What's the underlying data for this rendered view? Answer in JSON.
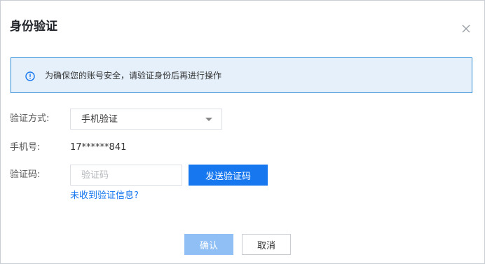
{
  "dialog": {
    "title": "身份验证",
    "close_icon": "close-icon"
  },
  "notice": {
    "icon": "info-circle-icon",
    "text": "为确保您的账号安全，请验证身份后再进行操作"
  },
  "form": {
    "method_label": "验证方式:",
    "method_value": "手机验证",
    "phone_label": "手机号:",
    "phone_value": "17******841",
    "code_label": "验证码:",
    "code_placeholder": "验证码",
    "code_value": "",
    "send_code_label": "发送验证码",
    "help_link": "未收到验证信息?"
  },
  "footer": {
    "confirm_label": "确认",
    "cancel_label": "取消"
  },
  "colors": {
    "accent": "#1677ee",
    "accent_disabled": "#8fbff5",
    "notice_bg": "#e5f0fb",
    "notice_border": "#2f8cd8"
  }
}
